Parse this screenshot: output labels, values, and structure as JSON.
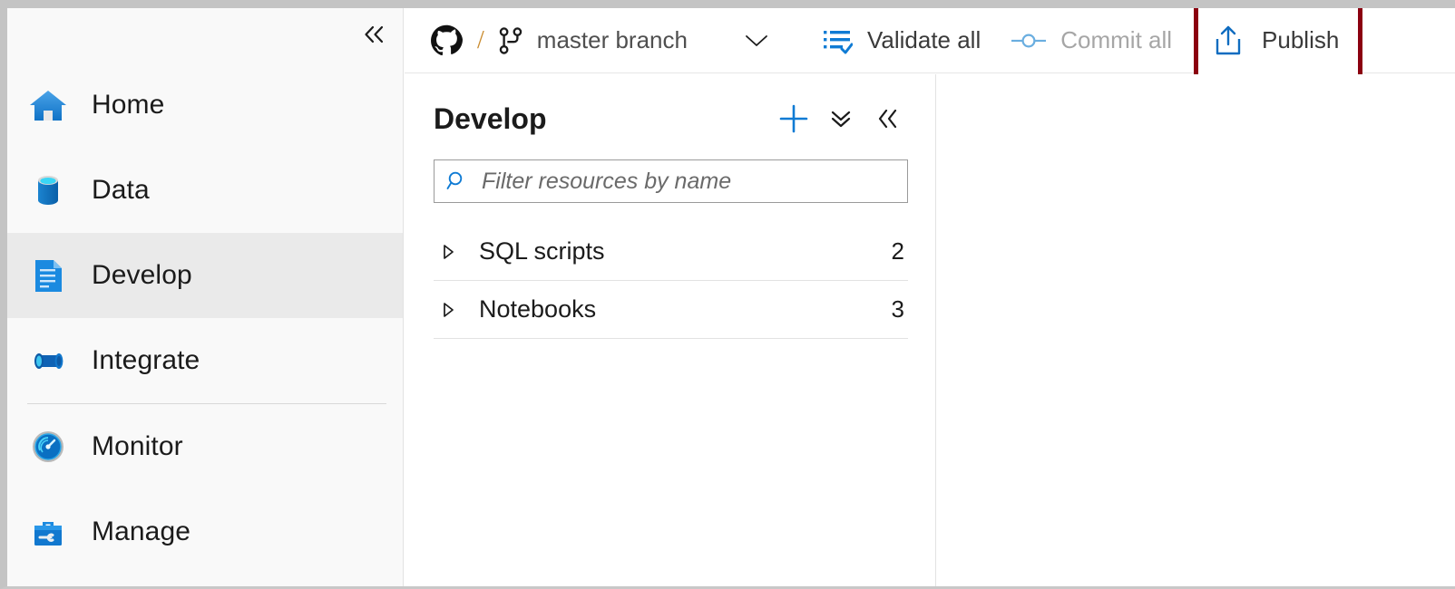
{
  "sidebar": {
    "collapse_icon": "double-chevron-left-icon",
    "items": [
      {
        "label": "Home",
        "icon": "home-icon",
        "active": false
      },
      {
        "label": "Data",
        "icon": "database-icon",
        "active": false
      },
      {
        "label": "Develop",
        "icon": "document-icon",
        "active": true
      },
      {
        "label": "Integrate",
        "icon": "pipeline-icon",
        "active": false
      },
      {
        "label": "Monitor",
        "icon": "gauge-icon",
        "active": false
      },
      {
        "label": "Manage",
        "icon": "toolbox-icon",
        "active": false
      }
    ],
    "separator_after_index": 3
  },
  "toolbar": {
    "repo_icon": "github-icon",
    "separator": "/",
    "branch_icon": "git-branch-icon",
    "branch_label": "master branch",
    "branch_caret_icon": "chevron-down-icon",
    "validate_label": "Validate all",
    "validate_icon": "validate-list-check-icon",
    "commit_label": "Commit all",
    "commit_icon": "commit-node-icon",
    "commit_disabled": true,
    "publish_label": "Publish",
    "publish_icon": "publish-upload-icon",
    "publish_highlight_color": "#8b0010"
  },
  "develop": {
    "title": "Develop",
    "new_icon": "plus-icon",
    "collapse_all_icon": "double-chevron-down-icon",
    "hide_panel_icon": "double-chevron-left-icon",
    "filter": {
      "icon": "search-icon",
      "placeholder": "Filter resources by name",
      "value": ""
    },
    "tree": [
      {
        "label": "SQL scripts",
        "count": "2",
        "expander_icon": "triangle-right-icon"
      },
      {
        "label": "Notebooks",
        "count": "3",
        "expander_icon": "triangle-right-icon"
      }
    ]
  },
  "colors": {
    "accent_blue": "#0f7bd4",
    "highlight_red": "#8b0010",
    "sidebar_bg": "#f9f9f9",
    "active_item_bg": "#eaeaea"
  }
}
